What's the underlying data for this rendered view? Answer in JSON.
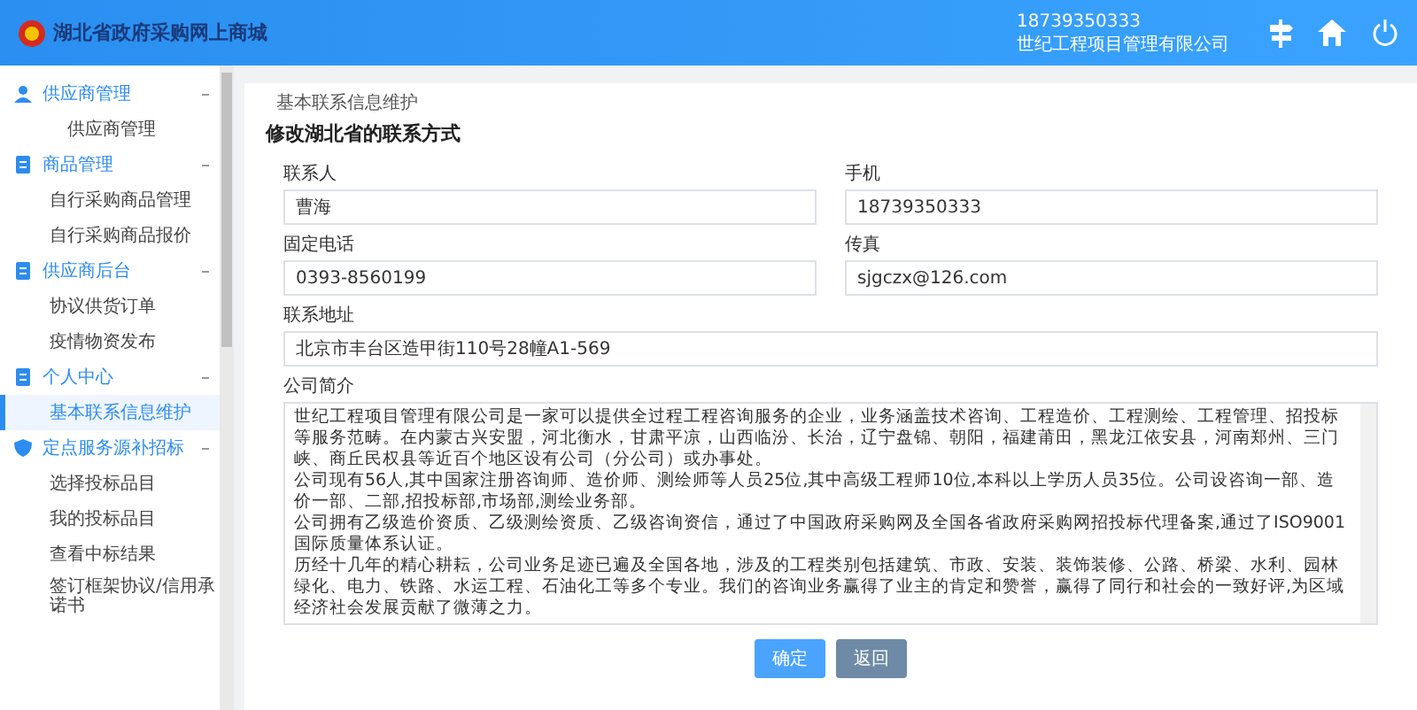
{
  "header": {
    "site_title": "湖北省政府采购网上商城",
    "user_phone": "18739350333",
    "user_company": "世纪工程项目管理有限公司"
  },
  "sidebar": {
    "groups": [
      {
        "label": "供应商管理",
        "expanded": true,
        "items": [
          {
            "label": "供应商管理",
            "selected": false
          }
        ]
      },
      {
        "label": "商品管理",
        "expanded": true,
        "items": [
          {
            "label": "自行采购商品管理",
            "selected": false
          },
          {
            "label": "自行采购商品报价",
            "selected": false
          }
        ]
      },
      {
        "label": "供应商后台",
        "expanded": true,
        "items": [
          {
            "label": "协议供货订单",
            "selected": false
          },
          {
            "label": "疫情物资发布",
            "selected": false
          }
        ]
      },
      {
        "label": "个人中心",
        "expanded": true,
        "items": [
          {
            "label": "基本联系信息维护",
            "selected": true
          }
        ]
      },
      {
        "label": "定点服务源补招标",
        "expanded": true,
        "items": [
          {
            "label": "选择投标品目",
            "selected": false
          },
          {
            "label": "我的投标品目",
            "selected": false
          },
          {
            "label": "查看中标结果",
            "selected": false
          },
          {
            "label": "签订框架协议/信用承诺书",
            "selected": false
          }
        ]
      }
    ]
  },
  "breadcrumb": "基本联系信息维护",
  "form": {
    "title": "修改湖北省的联系方式",
    "fields": [
      {
        "label": "联系人",
        "value": "曹海"
      },
      {
        "label": "手机",
        "value": "18739350333"
      },
      {
        "label": "固定电话",
        "value": "0393-8560199"
      },
      {
        "label": "传真",
        "value": "sjgczx@126.com"
      },
      {
        "label": "联系地址",
        "value": "北京市丰台区造甲街110号28幢A1-569"
      }
    ],
    "intro": {
      "label": "公司简介",
      "paragraphs": [
        "世纪工程项目管理有限公司是一家可以提供全过程工程咨询服务的企业，业务涵盖技术咨询、工程造价、工程测绘、工程管理、招投标等服务范畴。在内蒙古兴安盟，河北衡水，甘肃平凉，山西临汾、长治，辽宁盘锦、朝阳，福建莆田，黑龙江依安县，河南郑州、三门峡、商丘民权县等近百个地区设有公司（分公司）或办事处。",
        "公司现有56人,其中国家注册咨询师、造价师、测绘师等人员25位,其中高级工程师10位,本科以上学历人员35位。公司设咨询一部、造价一部、二部,招投标部,市场部,测绘业务部。",
        "公司拥有乙级造价资质、乙级测绘资质、乙级咨询资信，通过了中国政府采购网及全国各省政府采购网招投标代理备案,通过了ISO9001国际质量体系认证。",
        "历经十几年的精心耕耘，公司业务足迹已遍及全国各地，涉及的工程类别包括建筑、市政、安装、装饰装修、公路、桥梁、水利、园林绿化、电力、铁路、水运工程、石油化工等多个专业。我们的咨询业务赢得了业主的肯定和赞誉，赢得了同行和社会的一致好评,为区域经济社会发展贡献了微薄之力。"
      ]
    },
    "buttons": [
      {
        "label": "确定",
        "kind": "primary"
      },
      {
        "label": "返回",
        "kind": "secondary"
      }
    ]
  }
}
